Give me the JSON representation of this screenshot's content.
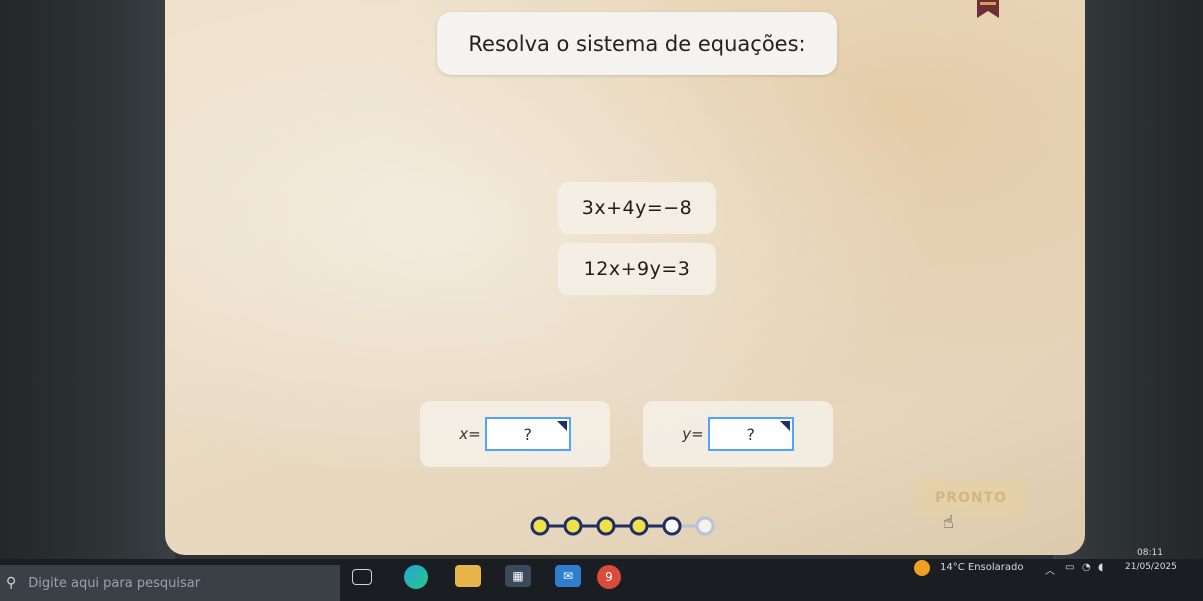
{
  "title": "Resolva o sistema de equações:",
  "equations": {
    "eq1": "3x+4y=−8",
    "eq2": "12x+9y=3"
  },
  "answers": {
    "x_label": "x=",
    "x_placeholder": "?",
    "y_label": "y=",
    "y_placeholder": "?"
  },
  "button": {
    "ready_label": "PRONTO"
  },
  "progress": {
    "completed": 4,
    "current": 1,
    "upcoming": 1,
    "total": 6
  },
  "taskbar": {
    "search_placeholder": "Digite aqui para pesquisar",
    "weather": "14°C Ensolarado",
    "time": "08:11",
    "date": "21/05/2025"
  },
  "colors": {
    "accent_blue": "#4da3ff",
    "progress_done": "#f0e04a",
    "progress_outline": "#1f2f66",
    "ready_button": "#ead296"
  },
  "icons": {
    "taskbar": [
      "task-view-icon",
      "edge-icon",
      "file-explorer-icon",
      "store-icon",
      "mail-icon",
      "app-icon"
    ]
  }
}
